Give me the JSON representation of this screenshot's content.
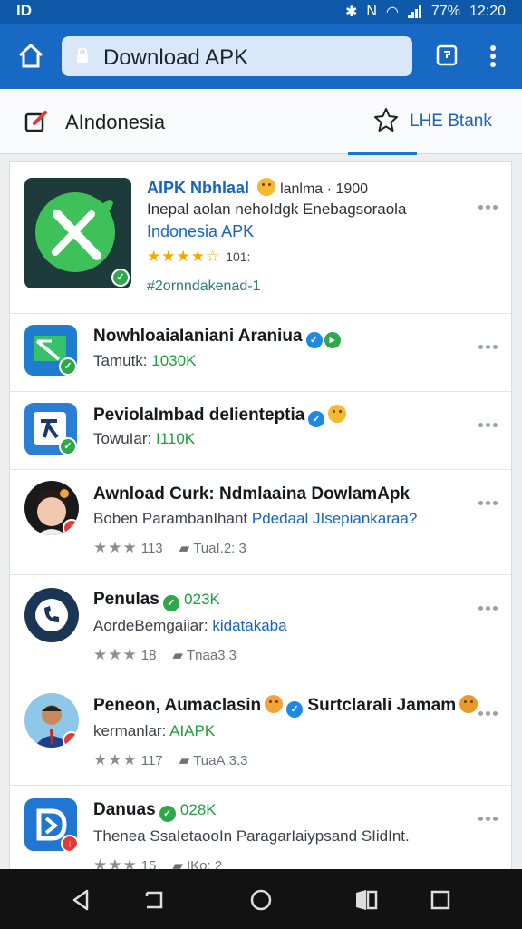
{
  "status_bar": {
    "left": "ID",
    "battery": "77%",
    "time": "12:20"
  },
  "header": {
    "url_text": "Download APK"
  },
  "category_bar": {
    "title": "AIndonesia",
    "favorites_label": "LHE Btank"
  },
  "featured": {
    "title": "AIPK Nbhlaal",
    "title_extra": "lanlma · 1900",
    "desc": "Inepal aolan nehoIdgk Enebagsoraola",
    "source": "Indonesia APK",
    "rating_text": "101:",
    "tag": "#2ornndakenad-1",
    "colors": {
      "icon_bg": "#1c3b3a",
      "icon_fg": "#3fc15a"
    }
  },
  "apps": [
    {
      "title": "NowhloaiaIaniani Araniua",
      "subtitle_label": "Tamutk:",
      "subtitle_value": "1030K",
      "icon": "map-share-icon",
      "badge": "check"
    },
    {
      "title": "PeviolaImbad deIienteptia",
      "subtitle_label": "TowuIar:",
      "subtitle_value": "I110K",
      "icon": "walk-figure-icon",
      "badge": "check"
    },
    {
      "title": "Awnload Curk: Ndmlaaina DowlamApk",
      "desc_label": "Boben ParambanIhant",
      "desc_value": "Pdedaal JIsepiankaraa?",
      "rating_count": "113",
      "downloads": "TuaI.2: 3",
      "icon": "avatar-woman-icon",
      "badge": "down"
    },
    {
      "title": "Penulas",
      "title_suffix": "023K",
      "desc_label": "AordeBemgaiiar:",
      "desc_value": "kidatakaba",
      "rating_count": "18",
      "downloads": "Tnaa3.3",
      "icon": "phone-icon",
      "badge": "none"
    },
    {
      "title": "Peneon, Aumaclasin",
      "title_suffix2": "Surtclarali Jamam",
      "desc_label": "kermanlar:",
      "desc_value": "AIAPK",
      "rating_count": "117",
      "downloads": "TuaA.3.3",
      "icon": "avatar-man-icon",
      "badge": "down"
    },
    {
      "title": "Danuas",
      "title_suffix": "028K",
      "desc_label": "Thenea SsaIetaooIn ParagarIaiypsand SIidInt.",
      "desc_value": "",
      "rating_count": "15",
      "downloads": "IKo: 2",
      "icon": "bird-logo-icon",
      "badge": "down"
    }
  ]
}
